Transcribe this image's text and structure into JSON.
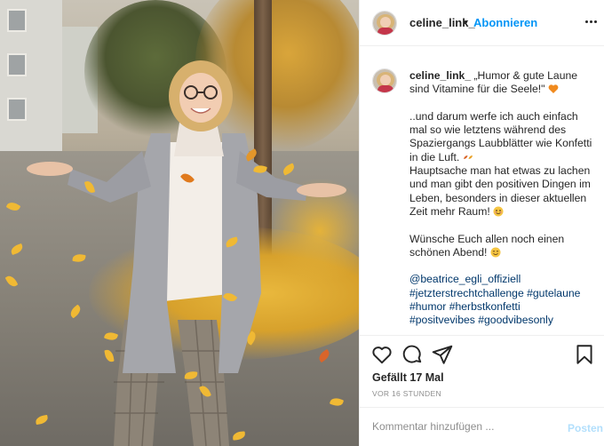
{
  "post": {
    "username": "celine_link_",
    "follow_label": "Abonnieren",
    "separator": "•",
    "caption_opening": "„Humor & gute Laune sind Vitamine für die Seele!\"",
    "caption_paragraph_1": "..und darum werfe ich auch einfach mal so wie letztens während des Spaziergangs Laubblätter wie Konfetti in die Luft.",
    "caption_paragraph_2": "Hauptsache man hat etwas zu lachen und man gibt den positiven Dingen im Leben, besonders in dieser aktuellen Zeit mehr Raum!",
    "caption_paragraph_3": "Wünsche Euch allen noch einen schönen Abend!",
    "tags_line_1": "@beatrice_egli_offiziell",
    "tags_line_2": "#jetzterstrechtchallenge #gutelaune",
    "tags_line_3": "#humor #herbstkonfetti",
    "tags_line_4": "#positvevibes #goodvibesonly",
    "likes": "Gefällt 17 Mal",
    "timestamp": "VOR 16 STUNDEN"
  },
  "comment": {
    "placeholder": "Kommentar hinzufügen ...",
    "post_label": "Posten"
  },
  "icons": [
    "more-icon",
    "heart-icon",
    "comment-icon",
    "share-icon",
    "bookmark-icon",
    "orange-heart-emoji",
    "leaf-emoji",
    "smiley-emoji"
  ],
  "colors": {
    "link_blue": "#0095f6",
    "hashtag_blue": "#00376b",
    "muted_gray": "#8e8e8e",
    "post_disabled": "#b2dffc",
    "orange_heart": "#f08a1e"
  }
}
